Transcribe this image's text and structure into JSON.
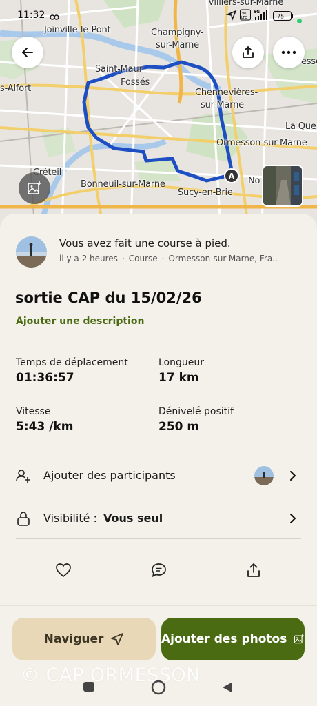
{
  "status_bar": {
    "time": "11:32",
    "battery": "75"
  },
  "map": {
    "labels": {
      "villiers": "Villiers-sur-Marne",
      "joinville": "Joinville-le-Pont",
      "champigny": "Champigny-\nsur-Marne",
      "saint_maur": "Saint-Maur",
      "saint_maur_2": "Fossés",
      "alfort": "s-Alfort",
      "chennevieres": "Chennevières-\nsur-Marne",
      "la_queue": "La Que",
      "ormesson": "Ormesson-sur-Marne",
      "creteil": "Créteil",
      "bonneuil": "Bonneuil-sur-Marne",
      "sucy": "Sucy-en-Brie",
      "noiseau": "No",
      "lesse": "esse",
      "marker": "A"
    }
  },
  "activity": {
    "headline": "Vous avez fait une course à pied.",
    "meta_time": "il y a 2 heures",
    "meta_type": "Course",
    "meta_place": "Ormesson-sur-Marne, Fra..",
    "title": "sortie CAP du 15/02/26",
    "add_description": "Ajouter une description"
  },
  "stats": [
    {
      "label": "Temps de déplacement",
      "value": "01:36:57"
    },
    {
      "label": "Longueur",
      "value": "17 km"
    },
    {
      "label": "Vitesse",
      "value": "5:43 /km"
    },
    {
      "label": "Dénivelé positif",
      "value": "250 m"
    }
  ],
  "rows": {
    "participants": "Ajouter des participants",
    "visibility_label": "Visibilité :",
    "visibility_value": "Vous seul"
  },
  "buttons": {
    "navigate": "Naviguer",
    "add_photos": "Ajouter des photos"
  },
  "watermark": "© CAP ORMESSON",
  "colors": {
    "accent": "#4b6b12",
    "navigate_bg": "#e8d8b7",
    "route": "#1e4fc2"
  }
}
